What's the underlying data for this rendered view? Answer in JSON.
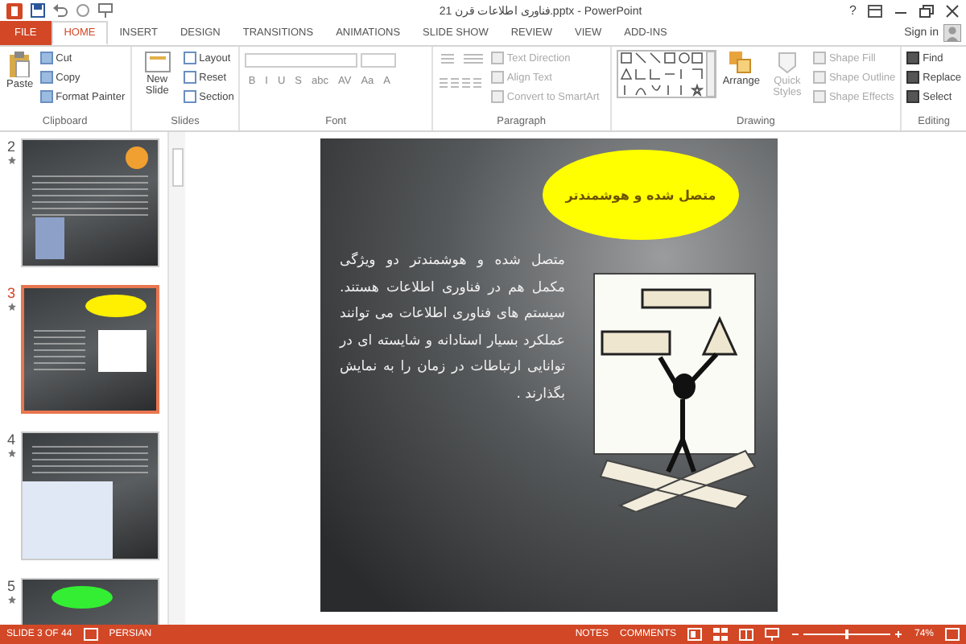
{
  "window": {
    "title": "فناوری اطلاعات قرن 21.pptx - PowerPoint",
    "sign_in": "Sign in",
    "help": "?"
  },
  "tabs": [
    {
      "label": "FILE",
      "kind": "file",
      "selected": false
    },
    {
      "label": "HOME",
      "kind": "tab",
      "selected": true
    },
    {
      "label": "INSERT",
      "kind": "tab",
      "selected": false
    },
    {
      "label": "DESIGN",
      "kind": "tab",
      "selected": false
    },
    {
      "label": "TRANSITIONS",
      "kind": "tab",
      "selected": false
    },
    {
      "label": "ANIMATIONS",
      "kind": "tab",
      "selected": false
    },
    {
      "label": "SLIDE SHOW",
      "kind": "tab",
      "selected": false
    },
    {
      "label": "REVIEW",
      "kind": "tab",
      "selected": false
    },
    {
      "label": "VIEW",
      "kind": "tab",
      "selected": false
    },
    {
      "label": "ADD-INS",
      "kind": "tab",
      "selected": false
    }
  ],
  "ribbon": {
    "clipboard": {
      "label": "Clipboard",
      "paste": "Paste",
      "commands": [
        {
          "label": "Cut",
          "disabled": false
        },
        {
          "label": "Copy",
          "disabled": false
        },
        {
          "label": "Format Painter",
          "disabled": false
        }
      ]
    },
    "slides": {
      "label": "Slides",
      "new_slide": "New Slide",
      "commands": [
        {
          "label": "Layout",
          "disabled": false
        },
        {
          "label": "Reset",
          "disabled": false
        },
        {
          "label": "Section",
          "disabled": false
        }
      ]
    },
    "font": {
      "label": "Font",
      "buttons": [
        "B",
        "I",
        "U",
        "S",
        "abc",
        "AV",
        "Aa",
        "A"
      ]
    },
    "paragraph": {
      "label": "Paragraph",
      "commands": [
        {
          "label": "Text Direction",
          "disabled": true
        },
        {
          "label": "Align Text",
          "disabled": true
        },
        {
          "label": "Convert to SmartArt",
          "disabled": true
        }
      ]
    },
    "drawing": {
      "label": "Drawing",
      "arrange": "Arrange",
      "quick_styles": "Quick Styles",
      "commands": [
        {
          "label": "Shape Fill",
          "disabled": true
        },
        {
          "label": "Shape Outline",
          "disabled": true
        },
        {
          "label": "Shape Effects",
          "disabled": true
        }
      ]
    },
    "editing": {
      "label": "Editing",
      "commands": [
        {
          "label": "Find",
          "disabled": false
        },
        {
          "label": "Replace",
          "disabled": false
        },
        {
          "label": "Select",
          "disabled": false
        }
      ]
    }
  },
  "thumbnails": [
    {
      "number": "2",
      "selected": false,
      "kind": "title"
    },
    {
      "number": "3",
      "selected": true,
      "kind": "ellipse"
    },
    {
      "number": "4",
      "selected": false,
      "kind": "picture"
    },
    {
      "number": "5",
      "selected": false,
      "kind": "green"
    }
  ],
  "slide": {
    "heading": "متصل شده و هوشمندتر",
    "body": "متصل شده و هوشمندتر دو ویژگی مکمل هم در فناوری اطلاعات هستند. سیستم های فناوری اطلاعات می توانند عملکرد بسیار استادانه و شایسته ای در توانایی ارتباطات در زمان را به نمایش بگذارند ."
  },
  "status_bar": {
    "slide": "SLIDE 3 OF 44",
    "language": "PERSIAN",
    "notes": "NOTES",
    "comments": "COMMENTS",
    "zoom": "74%",
    "zoom_slider": {
      "level": 0.5
    }
  }
}
